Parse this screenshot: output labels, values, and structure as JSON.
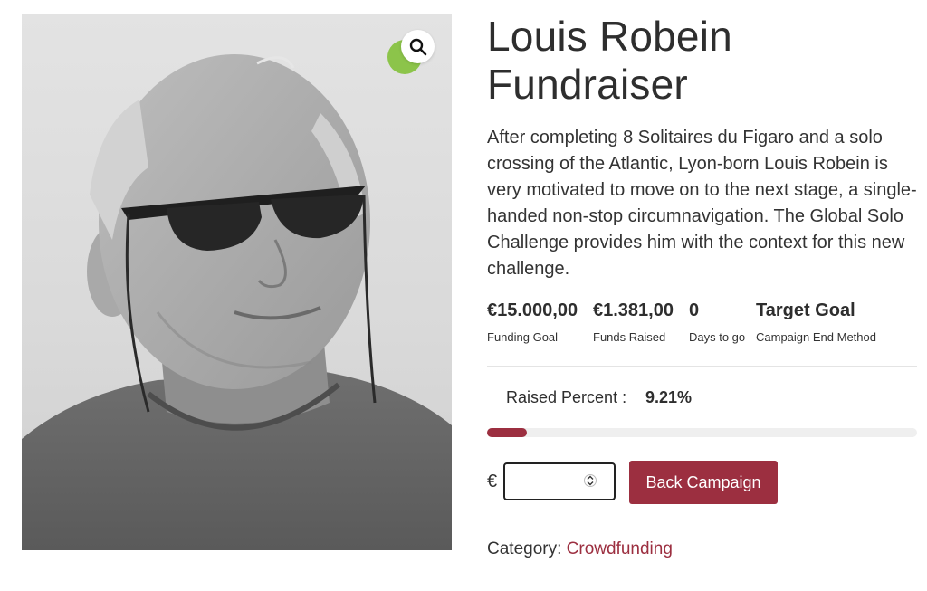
{
  "product": {
    "title_line1": "Louis Robein",
    "title_line2": "Fundraiser",
    "description": "After completing 8 Solitaires du Figaro and a solo crossing of the Atlantic, Lyon-born Louis Robein is very motivated to move on to the next stage, a single-handed non-stop circumnavigation. The Global Solo Challenge provides him with the context for this new challenge."
  },
  "stats": [
    {
      "value": "€15.000,00",
      "label": "Funding Goal"
    },
    {
      "value": "€1.381,00",
      "label": "Funds Raised"
    },
    {
      "value": "0",
      "label": "Days to go"
    },
    {
      "value": "Target Goal",
      "label": "Campaign End Method"
    }
  ],
  "raised": {
    "label": "Raised Percent :",
    "percent_text": "9.21%",
    "fraction": 0.0921
  },
  "donate": {
    "currency_symbol": "€",
    "amount_value": "",
    "button_label": "Back Campaign"
  },
  "category": {
    "label": "Category:",
    "link_text": "Crowdfunding"
  },
  "icons": {
    "zoom": "magnifier-icon",
    "badge": "green-badge-icon"
  },
  "colors": {
    "accent": "#9c2f40",
    "badge_green": "#8cc44a",
    "progress_track": "#efefef"
  }
}
